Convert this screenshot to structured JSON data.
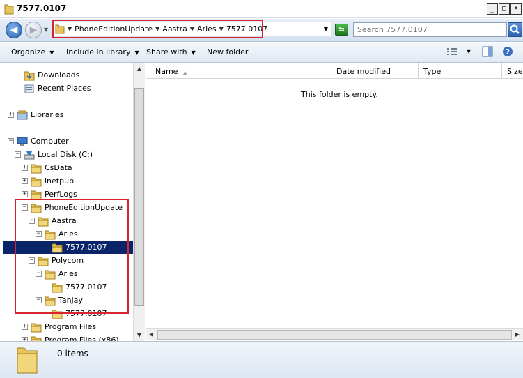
{
  "window": {
    "title": "7577.0107",
    "controls": {
      "minimize": "_",
      "maximize": "□",
      "close": "X"
    }
  },
  "address": {
    "crumbs": [
      "PhoneEditionUpdate",
      "Aastra",
      "Aries",
      "7577.0107"
    ]
  },
  "search": {
    "placeholder": "Search 7577.0107"
  },
  "toolbar": {
    "organize": "Organize",
    "include_in_library": "Include in library",
    "share_with": "Share with",
    "new_folder": "New folder"
  },
  "tree": [
    {
      "label": "Downloads",
      "icon": "downloads-folder-icon"
    },
    {
      "label": "Recent Places",
      "icon": "recent-places-icon"
    },
    {
      "label": "Libraries",
      "icon": "libraries-icon",
      "expander": "+"
    },
    {
      "label": "Computer",
      "icon": "computer-icon",
      "expander": "−"
    },
    {
      "label": "Local Disk (C:)",
      "icon": "drive-icon",
      "expander": "−"
    },
    {
      "label": "CsData",
      "icon": "folder-icon",
      "expander": "+"
    },
    {
      "label": "inetpub",
      "icon": "folder-icon",
      "expander": "+"
    },
    {
      "label": "PerfLogs",
      "icon": "folder-icon",
      "expander": "+"
    },
    {
      "label": "PhoneEditionUpdate",
      "icon": "folder-icon",
      "expander": "−"
    },
    {
      "label": "Aastra",
      "icon": "folder-icon",
      "expander": "−"
    },
    {
      "label": "Aries",
      "icon": "folder-icon",
      "expander": "−"
    },
    {
      "label": "7577.0107",
      "icon": "folder-icon",
      "selected": true
    },
    {
      "label": "Polycom",
      "icon": "folder-icon",
      "expander": "−"
    },
    {
      "label": "Aries",
      "icon": "folder-icon",
      "expander": "−"
    },
    {
      "label": "7577.0107",
      "icon": "folder-icon"
    },
    {
      "label": "Tanjay",
      "icon": "folder-icon",
      "expander": "−"
    },
    {
      "label": "7577.0107",
      "icon": "folder-icon"
    },
    {
      "label": "Program Files",
      "icon": "folder-icon",
      "expander": "+"
    },
    {
      "label": "Program Files (x86)",
      "icon": "folder-icon",
      "expander": "+"
    }
  ],
  "columns": [
    "Name",
    "Date modified",
    "Type",
    "Size"
  ],
  "content": {
    "empty_message": "This folder is empty."
  },
  "details": {
    "item_count": "0 items"
  },
  "colors": {
    "selection": "#0a246a",
    "highlight_box": "#d8242c"
  }
}
